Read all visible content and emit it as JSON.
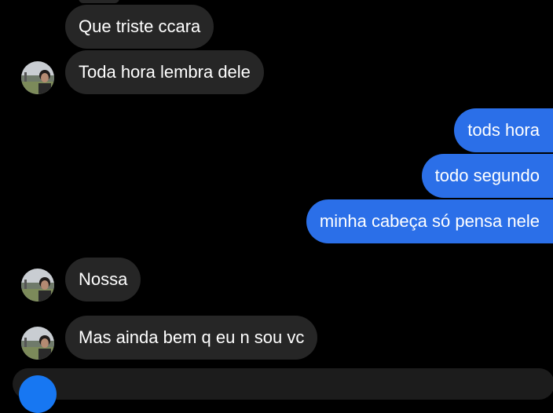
{
  "thread": {
    "messages": [
      {
        "sender": "contact",
        "text": "Que triste ccara"
      },
      {
        "sender": "contact",
        "text": "Toda hora lembra dele"
      },
      {
        "sender": "me",
        "text": "tods hora"
      },
      {
        "sender": "me",
        "text": "todo segundo"
      },
      {
        "sender": "me",
        "text": "minha cabeça só pensa nele"
      },
      {
        "sender": "contact",
        "text": "Nossa"
      },
      {
        "sender": "contact",
        "text": "Mas ainda bem q eu n sou vc"
      }
    ]
  },
  "colors": {
    "background": "#000000",
    "received_bubble": "#262626",
    "sent_bubble": "#2b6fe8",
    "text": "#ffffff"
  },
  "icons": {
    "avatar": "contact-avatar-photo",
    "composer": "camera-icon"
  }
}
